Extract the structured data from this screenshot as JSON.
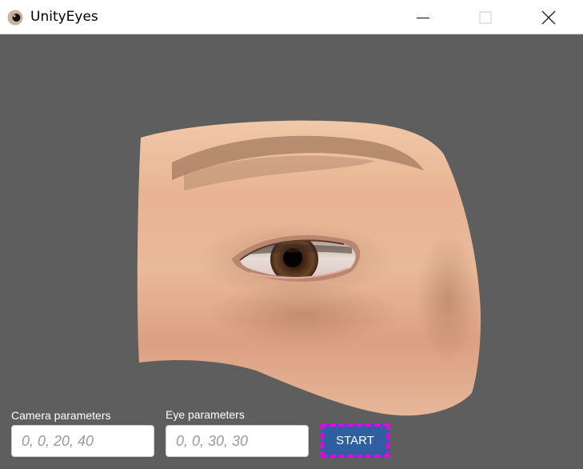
{
  "window": {
    "title": "UnityEyes",
    "icon": "eye-app-icon",
    "controls": [
      "minimize-icon",
      "maximize-icon",
      "close-icon"
    ]
  },
  "form": {
    "camera_label": "Camera parameters",
    "camera_placeholder": "0, 0, 20, 40",
    "camera_value": "",
    "eye_label": "Eye parameters",
    "eye_placeholder": "0, 0, 30, 30",
    "eye_value": "",
    "start_label": "START"
  },
  "colors": {
    "background": "#5e5e5e",
    "button": "#2f5fa0",
    "button_focus_outline": "#e800e8"
  }
}
